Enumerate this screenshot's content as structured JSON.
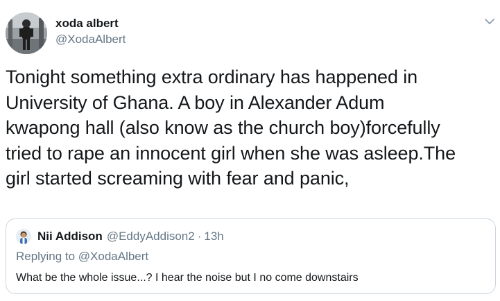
{
  "tweet": {
    "author": {
      "display_name": "xoda albert",
      "handle": "@XodaAlbert",
      "avatar_icon": "profile-photo"
    },
    "menu_icon": "chevron-down-icon",
    "text": "Tonight something extra ordinary has happened in\nUniversity of Ghana. A boy in Alexander Adum\nkwapong hall (also know as the church boy)forcefully\ntried to rape an innocent girl when she was asleep.The\ngirl started screaming with fear and panic,",
    "quoted": {
      "display_name": "Nii Addison",
      "handle": "@EddyAddison2",
      "separator": "·",
      "time": "13h",
      "replying_to": "Replying to @XodaAlbert",
      "text": "What be the whole issue...? I hear the noise but I no come downstairs"
    }
  },
  "colors": {
    "text_primary": "#14171a",
    "text_secondary": "#657786",
    "border": "#ccd6dd",
    "background": "#ffffff"
  }
}
